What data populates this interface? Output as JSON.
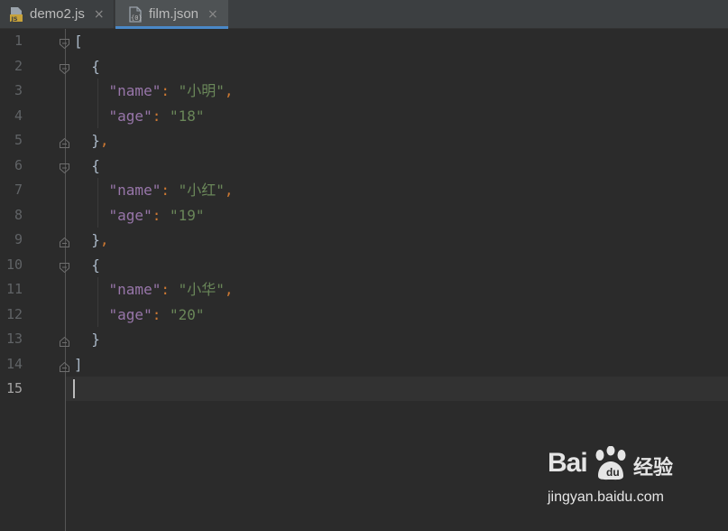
{
  "tabs": [
    {
      "label": "demo2.js",
      "icon": "js-file-icon",
      "active": false,
      "close": "×"
    },
    {
      "label": "film.json",
      "icon": "json-file-icon",
      "active": true,
      "close": "×"
    }
  ],
  "editor": {
    "current_line": 15,
    "line_numbers": [
      "1",
      "2",
      "3",
      "4",
      "5",
      "6",
      "7",
      "8",
      "9",
      "10",
      "11",
      "12",
      "13",
      "14",
      "15"
    ],
    "records": [
      {
        "name": "小明",
        "age": "18"
      },
      {
        "name": "小红",
        "age": "19"
      },
      {
        "name": "小华",
        "age": "20"
      }
    ],
    "tokens": {
      "open_array": "[",
      "close_array": "]",
      "open_obj": "{",
      "close_obj": "}",
      "comma": ",",
      "colon": ":",
      "key_name": "\"name\"",
      "key_age": "\"age\""
    }
  },
  "colors": {
    "background": "#2b2b2b",
    "key": "#9876aa",
    "string": "#6a8759",
    "punctuation": "#cc7832",
    "bracket": "#a9b7c6",
    "line_number": "#606366",
    "tab_accent": "#4a88c7"
  },
  "watermark": {
    "brand": "Baidu",
    "brand_cn": "经验",
    "url": "jingyan.baidu.com"
  }
}
